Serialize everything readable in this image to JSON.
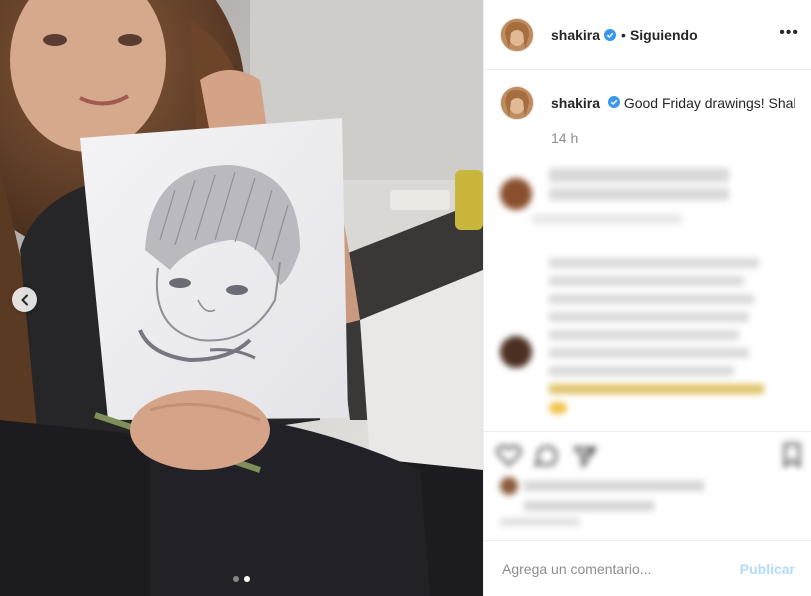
{
  "post": {
    "account": "shakira",
    "follow_separator": "•",
    "follow_status": "Siguiendo",
    "caption_user": "shakira",
    "caption_text": "Good Friday drawings! Shak",
    "timestamp": "14 h"
  },
  "carousel": {
    "dots": 2,
    "active_index": 1
  },
  "composer": {
    "placeholder": "Agrega un comentario...",
    "publish_label": "Publicar"
  },
  "colors": {
    "verified": "#3897f0",
    "publish_disabled": "#b3dbff",
    "muted": "#8e8e8e"
  },
  "icons": {
    "prev": "chevron-left-icon",
    "like": "heart-icon",
    "comment": "comment-icon",
    "share": "share-icon",
    "save": "bookmark-icon",
    "more": "more-icon",
    "verified": "verified-badge-icon"
  }
}
